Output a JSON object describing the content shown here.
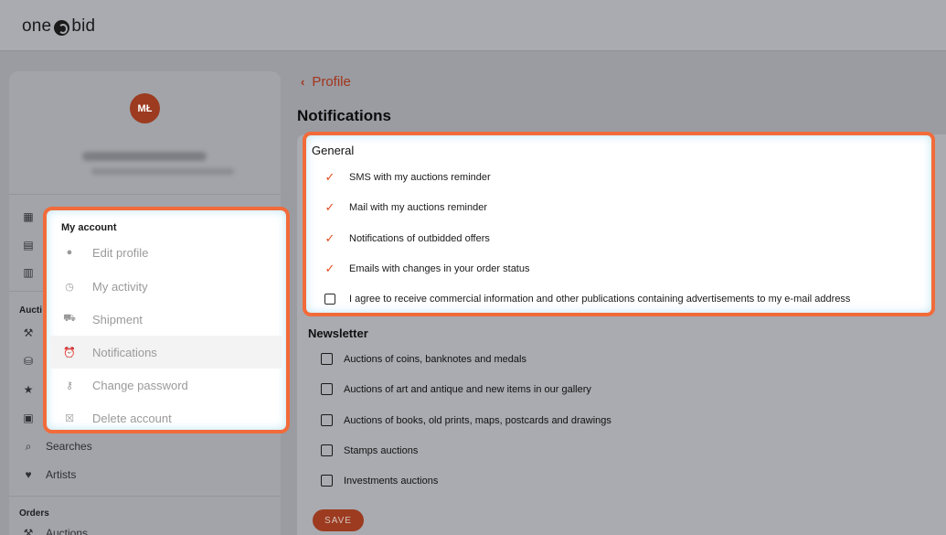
{
  "brand": {
    "logo_left": "one",
    "logo_right": "bid"
  },
  "sidebar": {
    "avatar_initials": "MŁ",
    "sections": {
      "auctions": "Aucti",
      "orders": "Orders"
    },
    "items": {
      "searches": "Searches",
      "artists": "Artists",
      "orders_auctions": "Auctions"
    }
  },
  "account_menu": {
    "title": "My account",
    "items": [
      {
        "label": "Edit profile",
        "icon": "user-icon"
      },
      {
        "label": "My activity",
        "icon": "clock-icon"
      },
      {
        "label": "Shipment",
        "icon": "truck-icon"
      },
      {
        "label": "Notifications",
        "icon": "alarm-icon",
        "active": true
      },
      {
        "label": "Change password",
        "icon": "key-icon"
      },
      {
        "label": "Delete account",
        "icon": "delete-icon"
      }
    ]
  },
  "main": {
    "back_label": "Profile",
    "title": "Notifications",
    "general": {
      "title": "General",
      "options": [
        {
          "label": "SMS with my auctions reminder",
          "checked": true
        },
        {
          "label": "Mail with my auctions reminder",
          "checked": true
        },
        {
          "label": "Notifications of outbidded offers",
          "checked": true
        },
        {
          "label": "Emails with changes in your order status",
          "checked": true
        },
        {
          "label": "I agree to receive commercial information and other publications containing advertisements to my e-mail address",
          "checked": false
        }
      ]
    },
    "newsletter": {
      "title": "Newsletter",
      "options": [
        {
          "label": "Auctions of coins, banknotes and medals",
          "checked": false
        },
        {
          "label": "Auctions of art and antique and new items in our gallery",
          "checked": false
        },
        {
          "label": "Auctions of books, old prints, maps, postcards and drawings",
          "checked": false
        },
        {
          "label": "Stamps auctions",
          "checked": false
        },
        {
          "label": "Investments auctions",
          "checked": false
        }
      ]
    },
    "save_label": "SAVE"
  },
  "colors": {
    "accent": "#f26b3a",
    "brand": "#9c3b20",
    "check": "#e24b21"
  }
}
